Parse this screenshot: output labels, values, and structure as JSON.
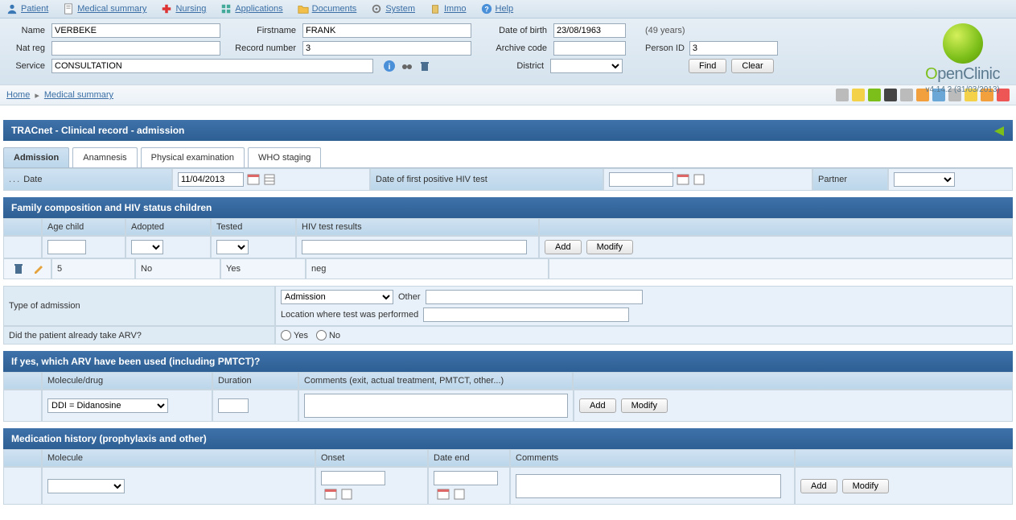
{
  "menu": {
    "patient": "Patient",
    "medical_summary": "Medical summary",
    "nursing": "Nursing",
    "applications": "Applications",
    "documents": "Documents",
    "system": "System",
    "immo": "Immo",
    "help": "Help"
  },
  "patient": {
    "name_label": "Name",
    "name_value": "VERBEKE",
    "firstname_label": "Firstname",
    "firstname_value": "FRANK",
    "dob_label": "Date of birth",
    "dob_value": "23/08/1963",
    "age_text": "(49 years)",
    "natreg_label": "Nat reg",
    "natreg_value": "",
    "recordnumber_label": "Record number",
    "recordnumber_value": "3",
    "archivecode_label": "Archive code",
    "archivecode_value": "",
    "personid_label": "Person ID",
    "personid_value": "3",
    "service_label": "Service",
    "service_value": "CONSULTATION",
    "district_label": "District",
    "find_btn": "Find",
    "clear_btn": "Clear"
  },
  "logo": {
    "brand1": "O",
    "brand_rest": "penClinic",
    "version": "v4.14.2 (31/03/2013)"
  },
  "breadcrumb": {
    "home": "Home",
    "current": "Medical summary"
  },
  "section_title": "TRACnet - Clinical record - admission",
  "tabs": {
    "admission": "Admission",
    "anamnesis": "Anamnesis",
    "physical": "Physical examination",
    "who": "WHO staging"
  },
  "admission": {
    "dots": "...",
    "date_label": "Date",
    "date_value": "11/04/2013",
    "hiv_label": "Date of first positive HIV test",
    "hiv_value": "",
    "partner_label": "Partner"
  },
  "family": {
    "header": "Family composition and HIV status children",
    "age_label": "Age child",
    "adopted_label": "Adopted",
    "tested_label": "Tested",
    "results_label": "HIV test results",
    "add_btn": "Add",
    "modify_btn": "Modify",
    "row": {
      "age": "5",
      "adopted": "No",
      "tested": "Yes",
      "results": "neg"
    }
  },
  "type_admission": {
    "label": "Type of admission",
    "select_value": "Admission",
    "other_label": "Other",
    "location_label": "Location where test was performed"
  },
  "arv_q": {
    "label": "Did the patient already take ARV?",
    "yes": "Yes",
    "no": "No"
  },
  "arv_used": {
    "header": "If yes, which ARV have been used (including PMTCT)?",
    "molecule_label": "Molecule/drug",
    "duration_label": "Duration",
    "comments_label": "Comments (exit, actual treatment, PMTCT, other...)",
    "molecule_value": "DDI = Didanosine",
    "add_btn": "Add",
    "modify_btn": "Modify"
  },
  "med_hist": {
    "header": "Medication history (prophylaxis and other)",
    "molecule_label": "Molecule",
    "onset_label": "Onset",
    "end_label": "Date end",
    "comments_label": "Comments",
    "add_btn": "Add",
    "modify_btn": "Modify"
  }
}
